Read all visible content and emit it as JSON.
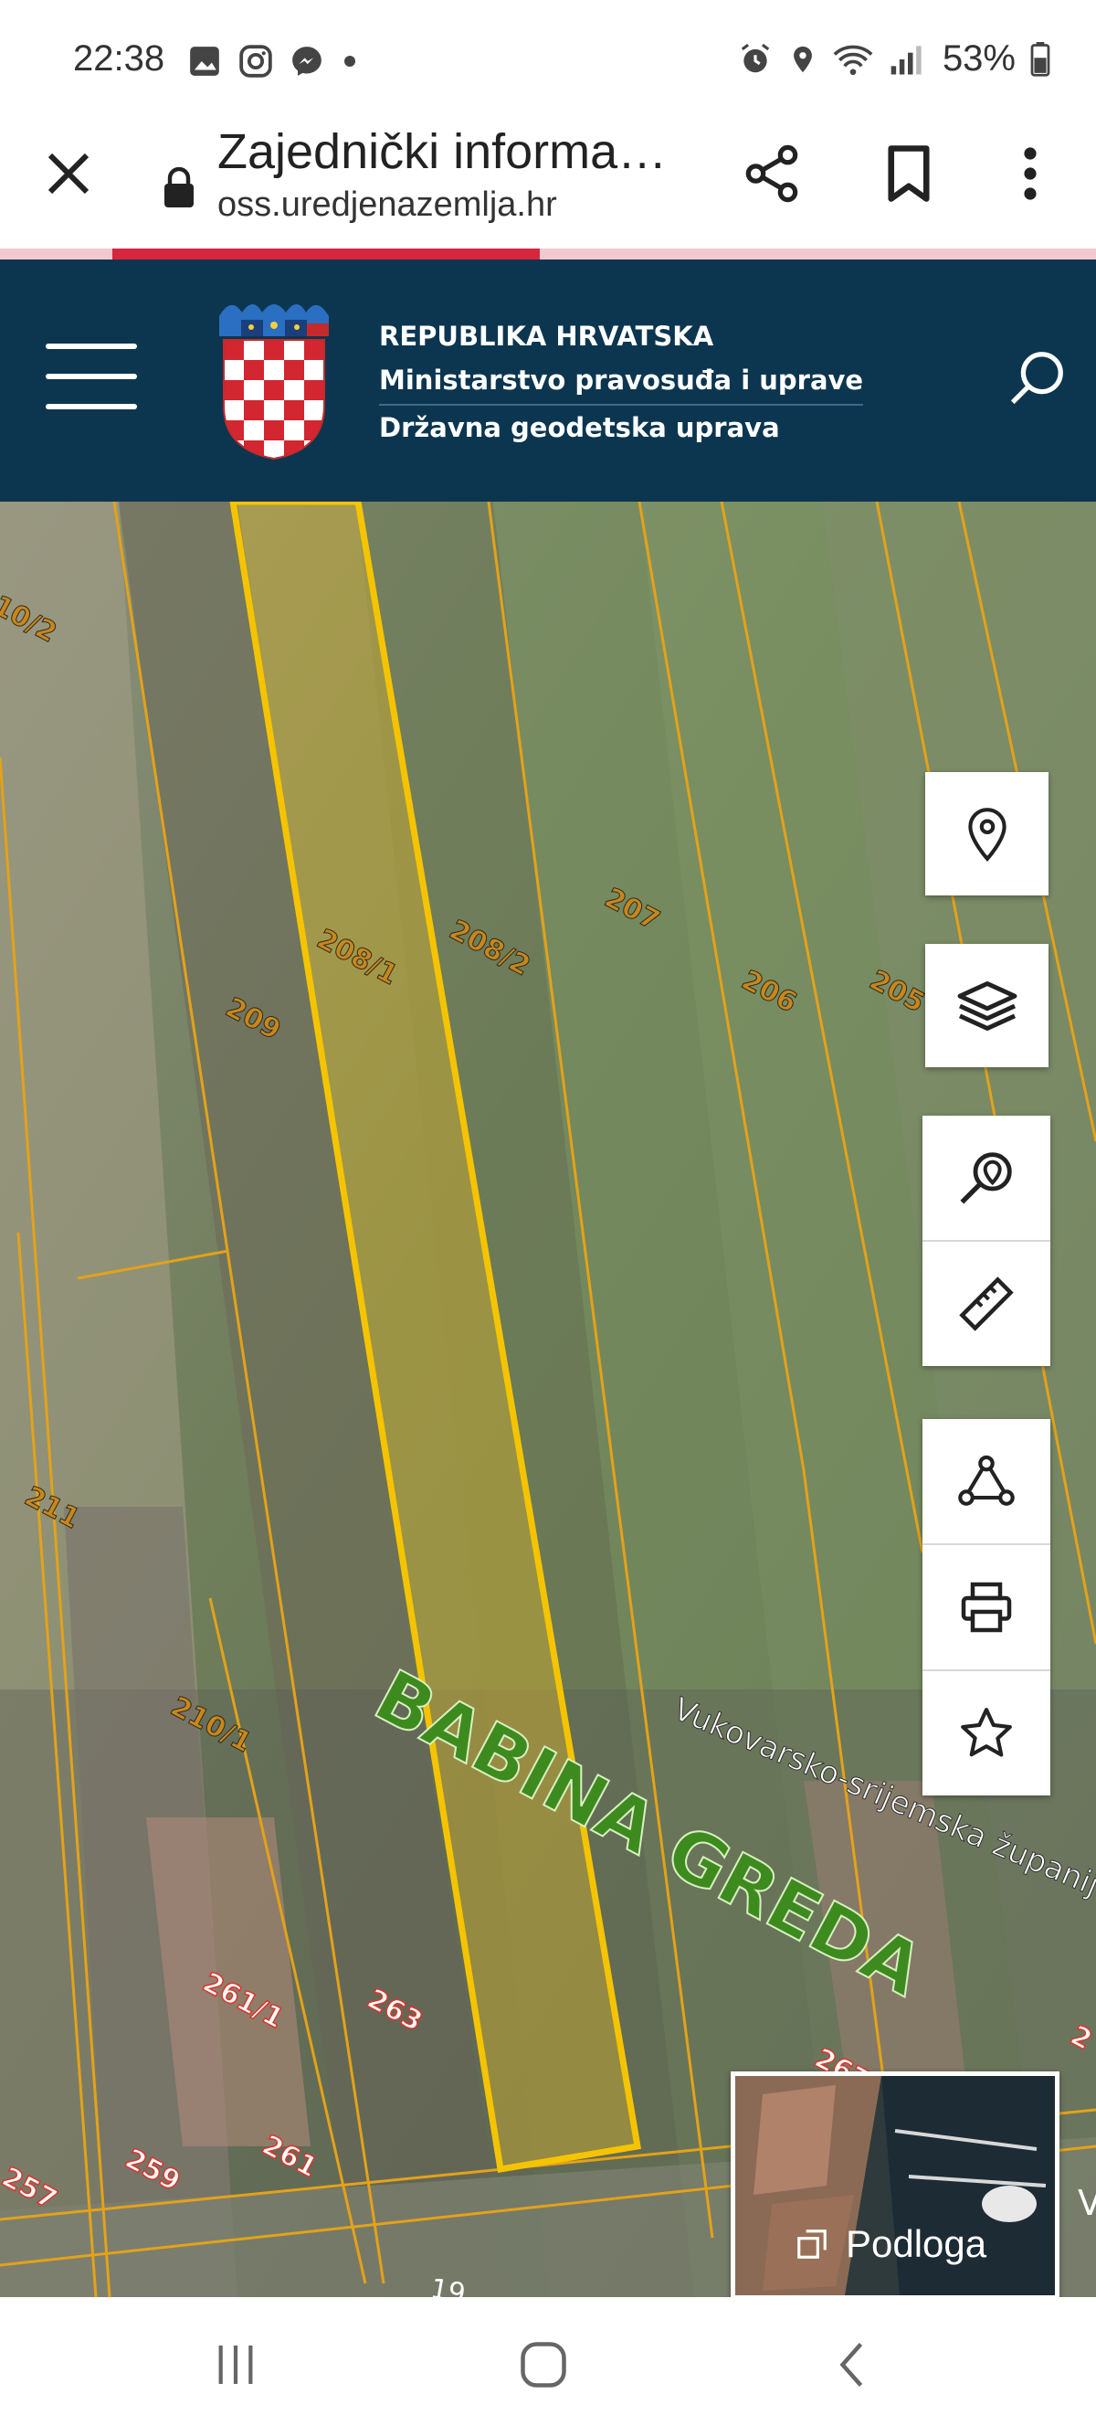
{
  "status_bar": {
    "time": "22:38",
    "battery": "53%",
    "icons_left": [
      "gallery-icon",
      "instagram-icon",
      "messenger-icon",
      "dot-icon"
    ],
    "icons_right": [
      "alarm-icon",
      "location-icon",
      "wifi-icon",
      "signal-icon",
      "battery-icon"
    ]
  },
  "browser": {
    "title": "Zajednički informa…",
    "url": "oss.uredjenazemlja.hr",
    "load_progress": 0.72
  },
  "header": {
    "line1": "REPUBLIKA HRVATSKA",
    "line2": "Ministarstvo pravosuđa i uprave",
    "line3": "Državna geodetska uprava"
  },
  "map": {
    "parcels": [
      "10/2",
      "208/1",
      "208/2",
      "207",
      "206",
      "205",
      "209",
      "211",
      "210/1",
      "261/1",
      "263",
      "267",
      "269",
      "257",
      "259",
      "261",
      "2"
    ],
    "place_label": "BABINA GREDA",
    "county_label": "Vukovarsko-srijemska županija",
    "bottom_fragment": "19",
    "edge_fragment": "V",
    "highlight_color": "#f5c400",
    "parcel_line_color": "#e3a21a",
    "parcel_label_color": "#c8861c"
  },
  "tools": [
    "location-pin-icon",
    "layers-icon",
    "search-location-icon",
    "ruler-icon",
    "polygon-icon",
    "print-icon",
    "star-icon"
  ],
  "basemap": {
    "label": "Podloga"
  }
}
